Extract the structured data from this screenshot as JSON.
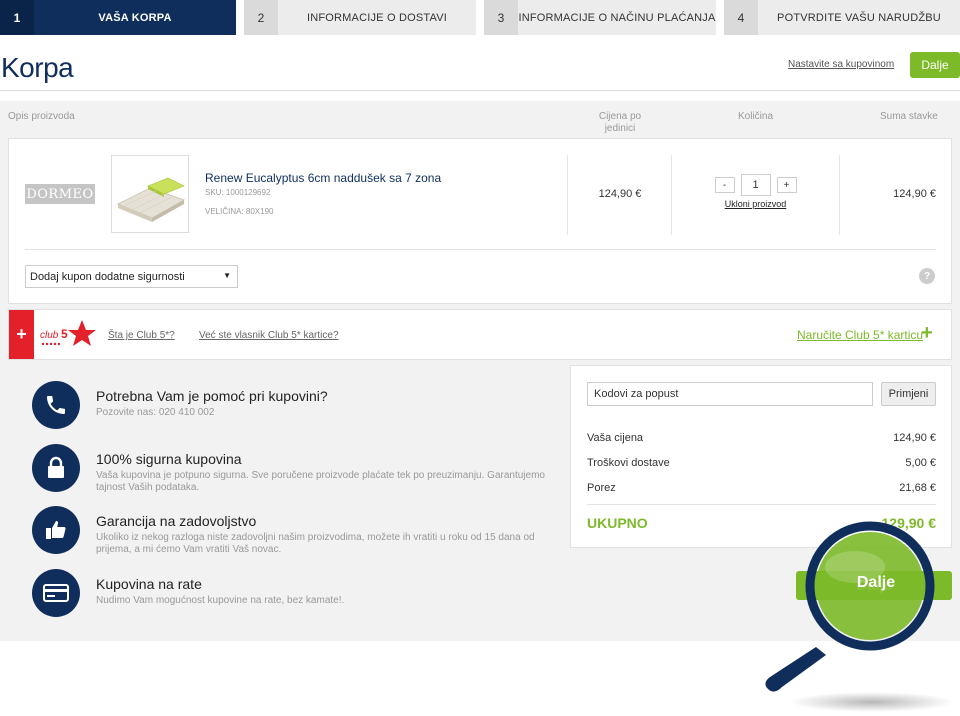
{
  "steps": [
    {
      "num": "1",
      "label": "VAŠA KORPA"
    },
    {
      "num": "2",
      "label": "INFORMACIJE O DOSTAVI"
    },
    {
      "num": "3",
      "label": "INFORMACIJE O NAČINU PLAĆANJA"
    },
    {
      "num": "4",
      "label": "POTVRDITE VAŠU NARUDŽBU"
    }
  ],
  "header": {
    "title": "Korpa",
    "continue_shopping": "Nastavite sa kupovinom",
    "next_label": "Dalje"
  },
  "columns": {
    "description": "Opis proizvoda",
    "unit_price": "Cijena po jedinici",
    "quantity": "Količina",
    "line_total": "Suma stavke"
  },
  "cart_item": {
    "brand": "DORMEO",
    "name": "Renew Eucalyptus 6cm naddušek sa 7 zona",
    "sku": "SKU: 1000129692",
    "size": "VELIČINA: 80X190",
    "unit_price": "124,90 €",
    "qty_minus": "-",
    "qty_value": "1",
    "qty_plus": "+",
    "remove": "Ukloni proizvod",
    "line_total": "124,90 €"
  },
  "coupon_select": {
    "selected": "Dodaj kupon dodatne sigurnosti",
    "arrow": "▼",
    "help": "?"
  },
  "club": {
    "plus": "+",
    "logo_text": "club",
    "logo_num": "5",
    "what_is": "Šta je Club 5*?",
    "already_member": "Već ste vlasnik Club 5* kartice?",
    "order_card": "Naručite Club 5* karticu",
    "order_plus": "+"
  },
  "features": [
    {
      "icon": "phone-icon",
      "title": "Potrebna Vam je pomoć pri kupovini?",
      "text": "Pozovite nas: 020 410 002"
    },
    {
      "icon": "lock-icon",
      "title": "100% sigurna kupovina",
      "text": "Vaša kupovina je potpuno sigurna. Sve poručene proizvode plaćate tek po preuzimanju. Garantujemo tajnost Vaših podataka."
    },
    {
      "icon": "thumbs-up-icon",
      "title": "Garancija na zadovoljstvo",
      "text": "Ukoliko iz nekog razloga niste zadovoljni našim proizvodima, možete ih vratiti u roku od 15 dana od prijema, a mi ćemo Vam vratiti Vaš novac."
    },
    {
      "icon": "credit-card-icon",
      "title": "Kupovina na rate",
      "text": "Nudimo Vam mogućnost kupovine na rate, bez kamate!."
    }
  ],
  "summary": {
    "discount_placeholder": "Kodovi za popust",
    "apply": "Primjeni",
    "rows": [
      {
        "label": "Vaša cijena",
        "value": "124,90 €"
      },
      {
        "label": "Troškovi dostave",
        "value": "5,00 €"
      },
      {
        "label": "Porez",
        "value": "21,68 €"
      }
    ],
    "total_label": "UKUPNO",
    "total_value": "129,90 €"
  },
  "main_next": "Dalje",
  "colors": {
    "navy": "#0f2e5c",
    "green": "#7cba29",
    "red": "#e4202a"
  }
}
